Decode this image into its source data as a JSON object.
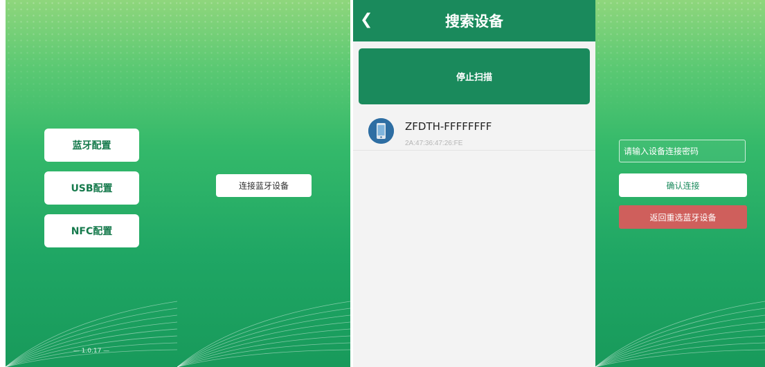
{
  "colors": {
    "brand_green": "#1a8a5c",
    "gradient_top": "#8fd67c",
    "gradient_bottom": "#189a5b",
    "danger_red": "#cf5f5c",
    "list_bg": "#f3f3f3"
  },
  "home": {
    "buttons": [
      "蓝牙配置",
      "USB配置",
      "NFC配置"
    ],
    "version": "— 1.0.17 —"
  },
  "connect_screen": {
    "connect_button": "连接蓝牙设备"
  },
  "search_screen": {
    "title": "搜索设备",
    "back_icon": "chevron-left-icon",
    "stop_scan_button": "停止扫描",
    "devices": [
      {
        "name": "ZFDTH-FFFFFFFF",
        "mac": "2A:47:36:47:26:FE",
        "icon": "phone-device-icon"
      }
    ]
  },
  "password_screen": {
    "password_placeholder": "请输入设备连接密码",
    "confirm_button": "确认连接",
    "reselect_button": "返回重选蓝牙设备"
  }
}
